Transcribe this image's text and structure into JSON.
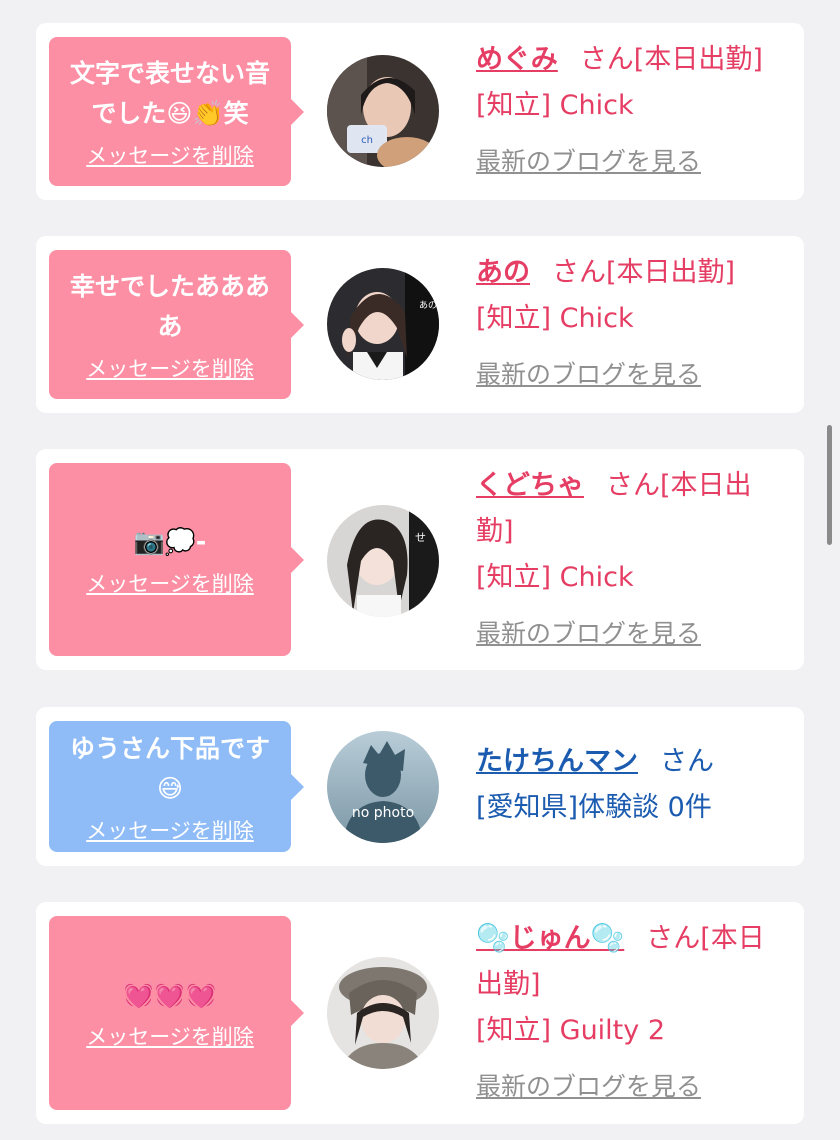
{
  "messages": [
    {
      "message": "文字で表せない音でした😆👏笑",
      "delete_label": "メッセージを削除",
      "name": "めぐみ",
      "honorific": "さん[本日出勤]",
      "shop": "[知立] Chick",
      "blog_link": "最新のブログを見る"
    },
    {
      "message": "幸せでしたああああ",
      "delete_label": "メッセージを削除",
      "name": "あの",
      "honorific": "さん[本日出勤]",
      "shop": "[知立] Chick",
      "blog_link": "最新のブログを見る"
    },
    {
      "message": "📷💭-",
      "delete_label": "メッセージを削除",
      "name": "くどちゃ",
      "honorific": "さん[本日出勤]",
      "shop": "[知立] Chick",
      "blog_link": "最新のブログを見る"
    },
    {
      "message": "ゆうさん下品です😅",
      "delete_label": "メッセージを削除",
      "name": "たけちんマン",
      "honorific": "さん",
      "shop": "[愛知県]体験談 0件",
      "avatar_text": "no photo"
    },
    {
      "message": "💓💓💓",
      "delete_label": "メッセージを削除",
      "name": "🫧じゅん🫧",
      "honorific": "さん[本日出勤]",
      "shop": "[知立] Guilty 2",
      "blog_link": "最新のブログを見る"
    }
  ],
  "colors": {
    "pink_bubble": "#fc8fa4",
    "blue_bubble": "#8fbcf7",
    "pink_text": "#e53d63",
    "blue_text": "#1b5bb0"
  }
}
